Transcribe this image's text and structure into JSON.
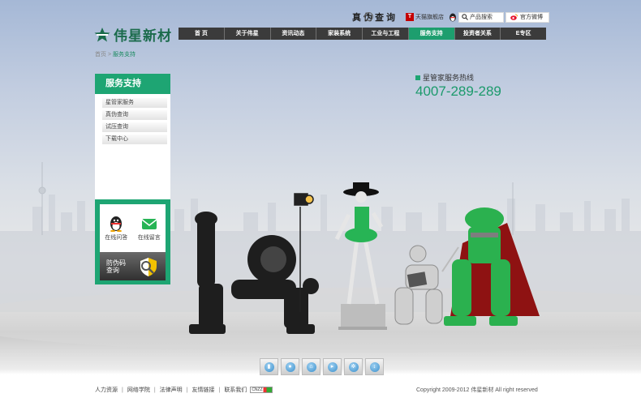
{
  "logo": {
    "text": "伟星新材"
  },
  "topbar": {
    "verify_text": "真伪查询",
    "tmall_badge": "T",
    "tmall_label": "天猫旗舰店",
    "search_label": "产品搜索",
    "weibo_label": "官方微博"
  },
  "nav": {
    "items": [
      "首 页",
      "关于伟星",
      "资讯动态",
      "家装系统",
      "工业与工程",
      "服务支持",
      "投资者关系",
      "E专区"
    ],
    "active_index": 5
  },
  "breadcrumb": {
    "home": "首页",
    "sep": ">",
    "current": "服务支持"
  },
  "sidebar": {
    "title": "服务支持",
    "items": [
      "星管家服务",
      "真伪查询",
      "试压查询",
      "下载中心"
    ],
    "online_qa": "在线问答",
    "online_msg": "在线留言",
    "anti_fake_line1": "防伪码",
    "anti_fake_line2": "查询"
  },
  "hotline": {
    "label": "星管家服务热线",
    "number": "4007-289-289"
  },
  "bottom_icons": [
    "chart-icon",
    "user-icon",
    "home-icon",
    "play-icon",
    "settings-icon",
    "download-icon"
  ],
  "footer": {
    "links": [
      "人力资源",
      "网络学院",
      "法律声明",
      "友情链接",
      "联系我们"
    ],
    "cnzz": "CNZZ",
    "copyright": "Copyright 2009-2012 伟星新材 All right reserved"
  },
  "colors": {
    "brand_green": "#1ea573",
    "nav_bg": "#3b3b3b",
    "hotline_green": "#1c9a6c"
  }
}
